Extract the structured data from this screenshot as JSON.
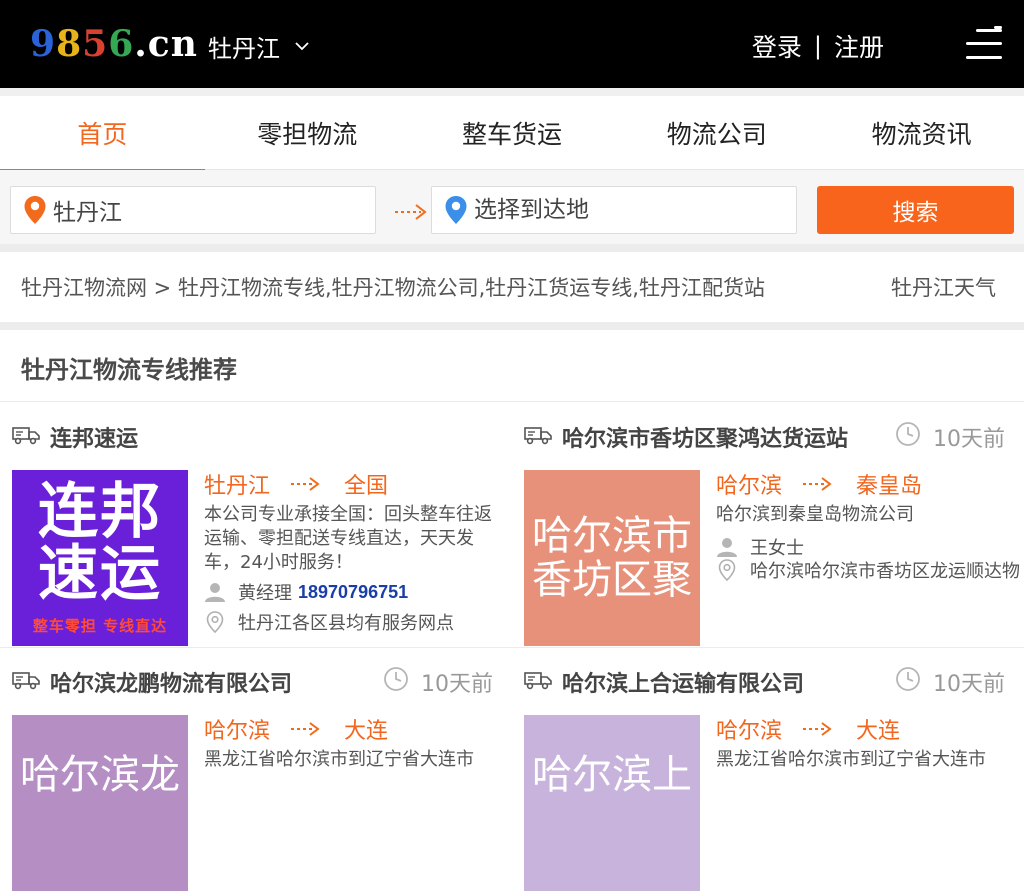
{
  "header": {
    "logo": {
      "d1": "9",
      "d2": "8",
      "d3": "5",
      "d4": "6",
      "dot": ".",
      "tld": "cn"
    },
    "city": "牡丹江",
    "login": "登录",
    "separator": "|",
    "register": "注册"
  },
  "nav": {
    "items": [
      {
        "label": "首页",
        "active": true
      },
      {
        "label": "零担物流"
      },
      {
        "label": "整车货运"
      },
      {
        "label": "物流公司"
      },
      {
        "label": "物流资讯"
      }
    ]
  },
  "search": {
    "from_value": "牡丹江",
    "to_placeholder": "选择到达地",
    "button": "搜索"
  },
  "breadcrumb": {
    "home": "牡丹江物流网",
    "sep": " > ",
    "current": "牡丹江物流专线,牡丹江物流公司,牡丹江货运专线,牡丹江配货站",
    "weather": "牡丹江天气"
  },
  "section": {
    "title": "牡丹江物流专线推荐"
  },
  "cards": [
    {
      "name": "连邦速运",
      "ago": "",
      "thumb_lines": [
        "连邦",
        "速运"
      ],
      "thumb_sub": "整车零担  专线直达",
      "from": "牡丹江",
      "to": "全国",
      "desc": "本公司专业承接全国：回头整车往返运输、零担配送专线直达，天天发车，24小时服务！",
      "contact": "黄经理",
      "phone": "18970796751",
      "address": "牡丹江各区县均有服务网点"
    },
    {
      "name": "哈尔滨市香坊区聚鸿达货运站",
      "ago": "10天前",
      "thumb_text": "哈尔滨市香坊区聚",
      "from": "哈尔滨",
      "to": "秦皇岛",
      "desc": "哈尔滨到秦皇岛物流公司",
      "contact": "王女士",
      "address": "哈尔滨哈尔滨市香坊区龙运顺达物"
    },
    {
      "name": "哈尔滨龙鹏物流有限公司",
      "ago": "10天前",
      "thumb_text": "哈尔滨龙",
      "from": "哈尔滨",
      "to": "大连",
      "desc": "黑龙江省哈尔滨市到辽宁省大连市"
    },
    {
      "name": "哈尔滨上合运输有限公司",
      "ago": "10天前",
      "thumb_text": "哈尔滨上",
      "from": "哈尔滨",
      "to": "大连",
      "desc": "黑龙江省哈尔滨市到辽宁省大连市"
    }
  ],
  "colors": {
    "accent": "#f8641b",
    "header_bg": "#000000",
    "phone": "#1a3ea8"
  },
  "icons": [
    "location-pin-icon",
    "dotted-arrow-icon",
    "truck-icon",
    "clock-icon",
    "user-icon",
    "map-pin-icon",
    "chevron-down-icon",
    "hamburger-menu-icon"
  ]
}
